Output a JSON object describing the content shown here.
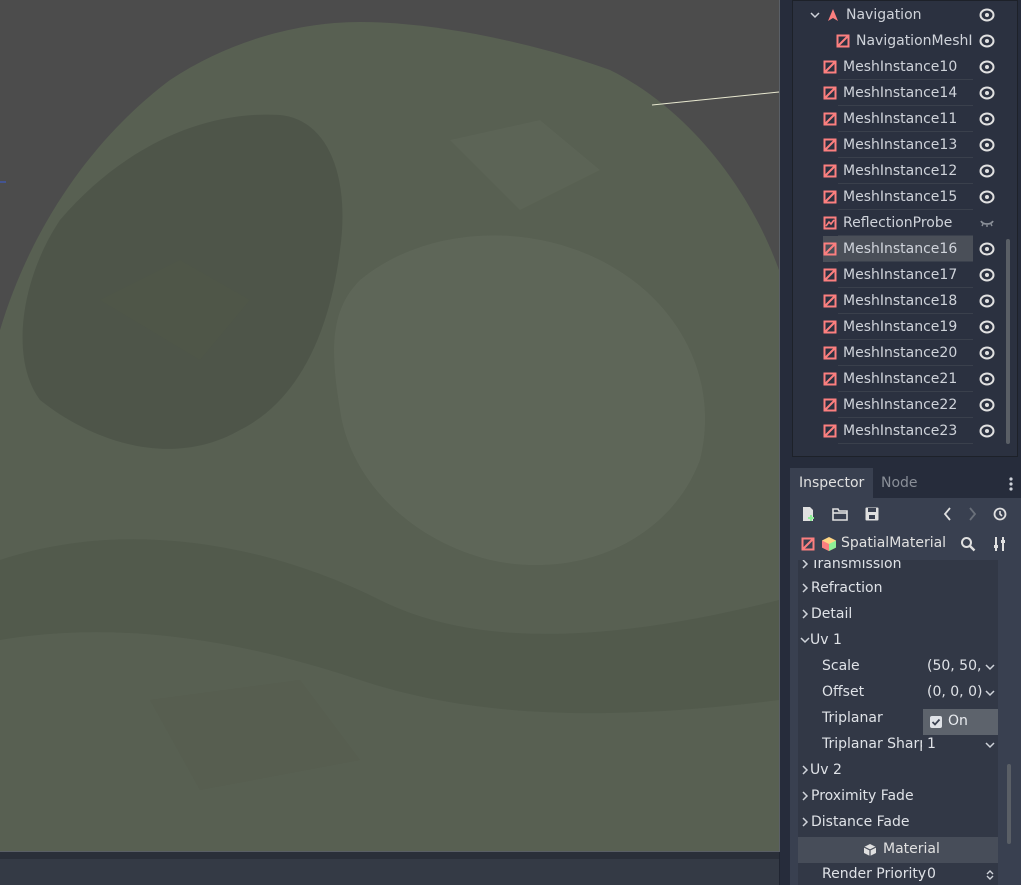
{
  "scene_tree": {
    "items": [
      {
        "label": "Navigation",
        "icon": "navigation-icon",
        "expanded": true,
        "visibility": "eye-icon"
      },
      {
        "label": "NavigationMeshIn",
        "icon": "navigation-mesh-instance-icon",
        "visibility": "eye-icon"
      },
      {
        "label": "MeshInstance10",
        "icon": "mesh-instance-icon",
        "visibility": "eye-icon"
      },
      {
        "label": "MeshInstance14",
        "icon": "mesh-instance-icon",
        "visibility": "eye-icon"
      },
      {
        "label": "MeshInstance11",
        "icon": "mesh-instance-icon",
        "visibility": "eye-icon"
      },
      {
        "label": "MeshInstance13",
        "icon": "mesh-instance-icon",
        "visibility": "eye-icon"
      },
      {
        "label": "MeshInstance12",
        "icon": "mesh-instance-icon",
        "visibility": "eye-icon"
      },
      {
        "label": "MeshInstance15",
        "icon": "mesh-instance-icon",
        "visibility": "eye-icon"
      },
      {
        "label": "ReflectionProbe",
        "icon": "reflection-probe-icon",
        "visibility": "eye-closed-icon"
      },
      {
        "label": "MeshInstance16",
        "icon": "mesh-instance-icon",
        "visibility": "eye-icon",
        "selected": true
      },
      {
        "label": "MeshInstance17",
        "icon": "mesh-instance-icon",
        "visibility": "eye-icon"
      },
      {
        "label": "MeshInstance18",
        "icon": "mesh-instance-icon",
        "visibility": "eye-icon"
      },
      {
        "label": "MeshInstance19",
        "icon": "mesh-instance-icon",
        "visibility": "eye-icon"
      },
      {
        "label": "MeshInstance20",
        "icon": "mesh-instance-icon",
        "visibility": "eye-icon"
      },
      {
        "label": "MeshInstance21",
        "icon": "mesh-instance-icon",
        "visibility": "eye-icon"
      },
      {
        "label": "MeshInstance22",
        "icon": "mesh-instance-icon",
        "visibility": "eye-icon"
      },
      {
        "label": "MeshInstance23",
        "icon": "mesh-instance-icon",
        "visibility": "eye-icon"
      }
    ]
  },
  "dock_tabs": {
    "inspector": "Inspector",
    "node": "Node"
  },
  "inspector": {
    "object_name": "SpatialMaterial",
    "sections_before": [
      "Transmission",
      "Refraction",
      "Detail"
    ],
    "uv1": {
      "label": "Uv 1",
      "scale_label": "Scale",
      "scale_value": "(50, 50,",
      "offset_label": "Offset",
      "offset_value": "(0, 0, 0)",
      "triplanar_label": "Triplanar",
      "triplanar_value": "On",
      "triplanar_sharp_label": "Triplanar Sharp",
      "triplanar_sharp_value": "1"
    },
    "sections_after": [
      "Uv 2",
      "Proximity Fade",
      "Distance Fade"
    ],
    "material_header": "Material",
    "render_priority_label": "Render Priority",
    "render_priority_value": "0"
  },
  "colors": {
    "mesh_icon": "#fc7f7f",
    "accent_yellow": "#ffd684",
    "material_icon_green": "#8eef97",
    "terrain": "#586052"
  }
}
